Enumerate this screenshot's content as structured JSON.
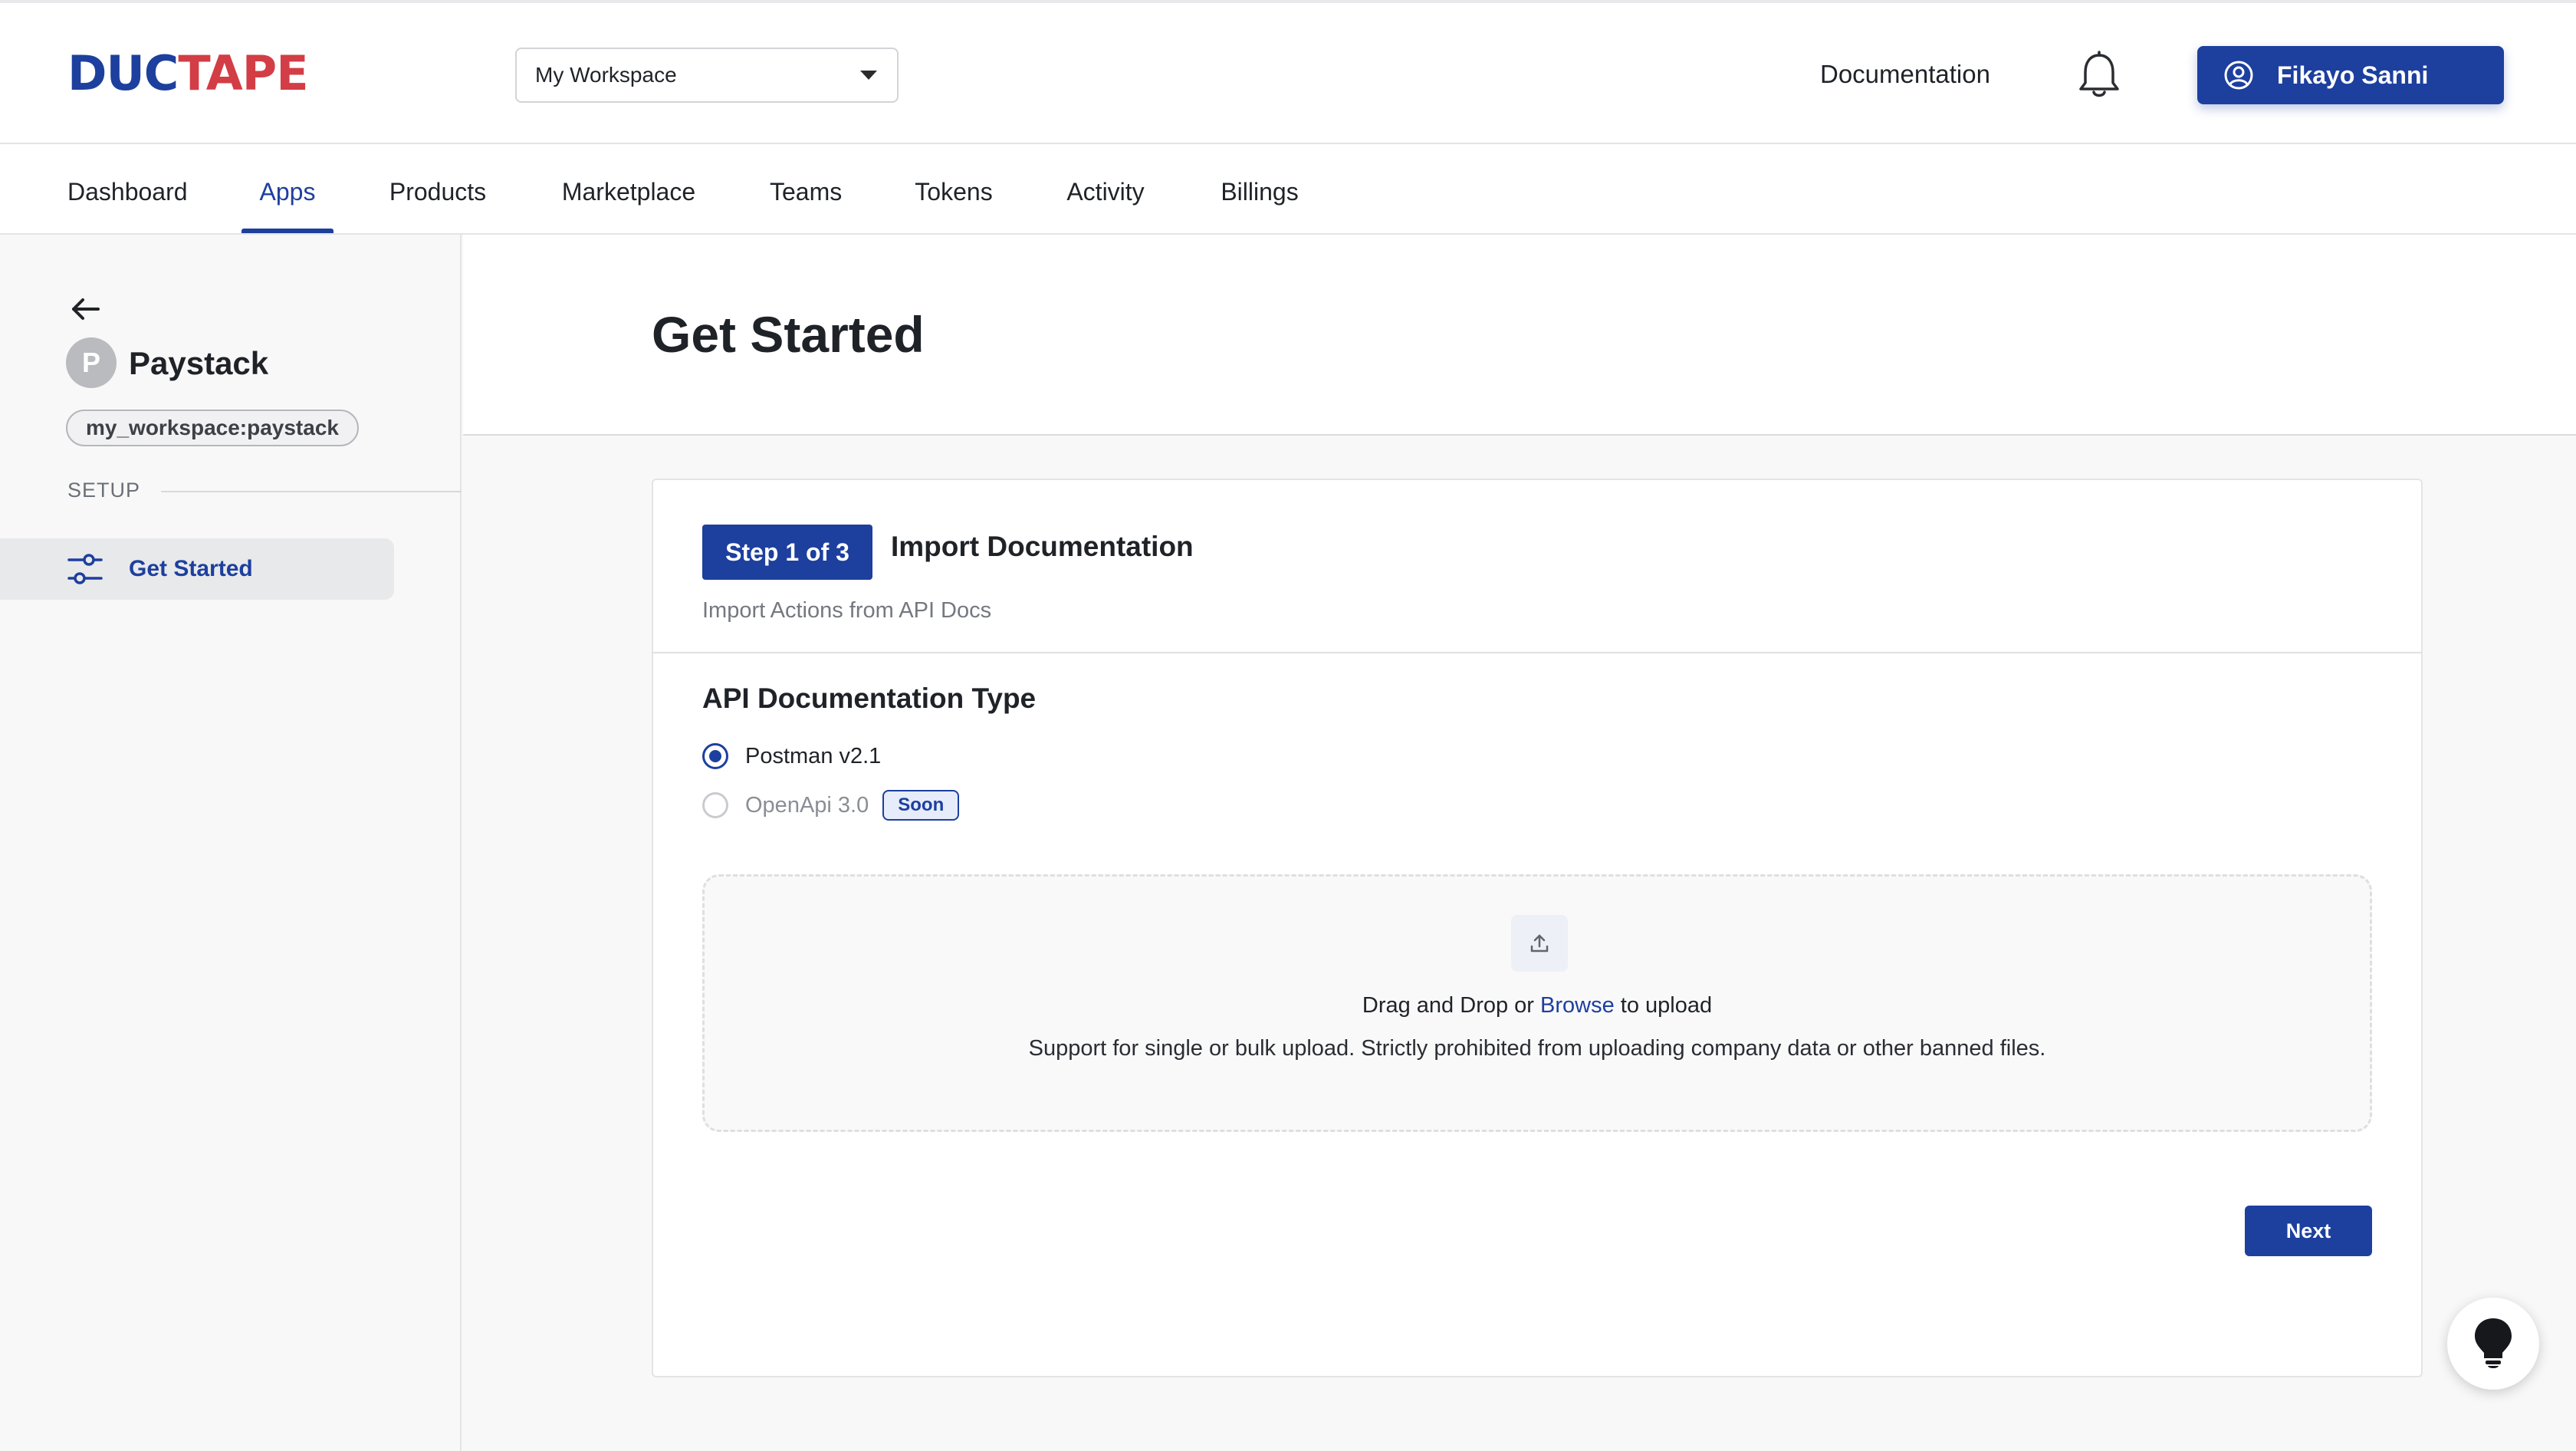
{
  "brand": {
    "part1": "DUC",
    "part2": "TAPE",
    "color_primary": "#1d3f9e",
    "color_accent": "#d33d45"
  },
  "header": {
    "workspace_select": "My Workspace",
    "documentation_link": "Documentation",
    "user_name": "Fikayo Sanni",
    "icons": [
      "bell-icon",
      "user-circle-icon",
      "chevron-down-icon"
    ]
  },
  "nav": {
    "tabs": [
      {
        "label": "Dashboard",
        "active": false
      },
      {
        "label": "Apps",
        "active": true
      },
      {
        "label": "Products",
        "active": false
      },
      {
        "label": "Marketplace",
        "active": false
      },
      {
        "label": "Teams",
        "active": false
      },
      {
        "label": "Tokens",
        "active": false
      },
      {
        "label": "Activity",
        "active": false
      },
      {
        "label": "Billings",
        "active": false
      }
    ]
  },
  "sidebar": {
    "app_initial": "P",
    "app_name": "Paystack",
    "app_slug": "my_workspace:paystack",
    "section_label": "SETUP",
    "items": [
      {
        "label": "Get Started",
        "active": true,
        "icon": "sliders-icon"
      }
    ]
  },
  "main": {
    "page_title": "Get Started",
    "step": {
      "badge": "Step 1 of 3",
      "title": "Import Documentation",
      "subtitle": "Import Actions from API Docs"
    },
    "doc_type": {
      "title": "API Documentation Type",
      "options": [
        {
          "label": "Postman v2.1",
          "selected": true,
          "disabled": false
        },
        {
          "label": "OpenApi 3.0",
          "selected": false,
          "disabled": true,
          "badge": "Soon"
        }
      ]
    },
    "dropzone": {
      "line1_before": "Drag and Drop or ",
      "line1_link": "Browse",
      "line1_after": " to upload",
      "line2": "Support for single or bulk upload. Strictly prohibited from uploading company data or other banned files."
    },
    "next_label": "Next"
  }
}
